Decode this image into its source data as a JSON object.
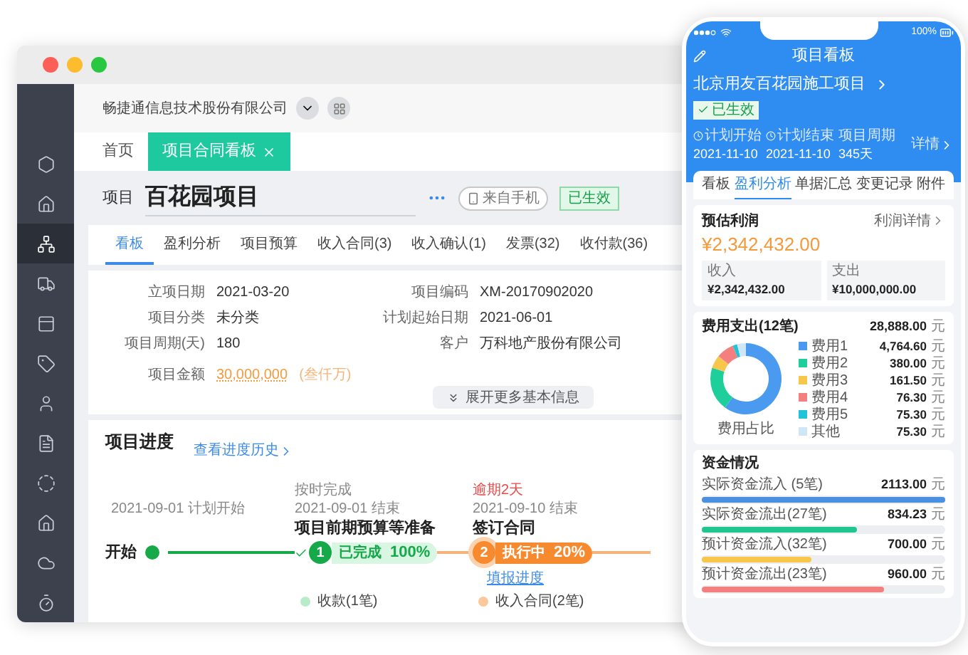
{
  "window": {
    "company": "畅捷通信息技术股份有限公司"
  },
  "sidebar": [
    {
      "selected": false
    },
    {
      "selected": false
    },
    {
      "selected": true
    },
    {
      "selected": false
    },
    {
      "selected": false
    },
    {
      "selected": false
    },
    {
      "selected": false
    },
    {
      "selected": false
    },
    {
      "selected": false
    },
    {
      "selected": false
    },
    {
      "selected": false
    },
    {
      "selected": false
    }
  ],
  "page_tabs": [
    {
      "label": "首页",
      "selected": false,
      "closable": false
    },
    {
      "label": "项目合同看板",
      "selected": true,
      "closable": true
    }
  ],
  "project": {
    "prefix": "项目",
    "name": "百花园项目",
    "source": "来自手机",
    "status": "已生效"
  },
  "tabs": [
    {
      "label": "看板",
      "selected": true
    },
    {
      "label": "盈利分析",
      "selected": false
    },
    {
      "label": "项目预算",
      "selected": false
    },
    {
      "label": "收入合同(3)",
      "selected": false
    },
    {
      "label": "收入确认(1)",
      "selected": false
    },
    {
      "label": "发票(32)",
      "selected": false
    },
    {
      "label": "收付款(36)",
      "selected": false
    }
  ],
  "info": {
    "left": [
      {
        "label": "立项日期",
        "value": "2021-03-20"
      },
      {
        "label": "项目分类",
        "value": "未分类"
      },
      {
        "label": "项目周期(天)",
        "value": "180"
      }
    ],
    "right": [
      {
        "label": "项目编码",
        "value": "XM-20170902020"
      },
      {
        "label": "计划起始日期",
        "value": "2021-06-01"
      },
      {
        "label": "客户",
        "value": "万科地产股份有限公司"
      }
    ],
    "amount": {
      "label": "项目金额",
      "value": "30,000,000",
      "words": "(叁仟万)"
    },
    "expand": "展开更多基本信息"
  },
  "progress": {
    "title": "项目进度",
    "history_link": "查看进度历史",
    "start": {
      "date": "2021-09-01 计划开始",
      "label": "开始"
    },
    "steps": [
      {
        "kind": "done",
        "number": "1",
        "note": "按时完成",
        "late": false,
        "date": "2021-09-01 结束",
        "title": "项目前期预算等准备",
        "state": "已完成",
        "percent": "100%",
        "items": [
          "收款(1笔)"
        ]
      },
      {
        "kind": "active",
        "number": "2",
        "note": "逾期2天",
        "late": true,
        "date": "2021-09-10 结束",
        "title": "签订合同",
        "state": "执行中",
        "percent": "20%",
        "link": "填报进度",
        "items": [
          "收入合同(2笔)"
        ]
      }
    ]
  },
  "phone": {
    "battery": "100%",
    "title": "项目看板",
    "project": "北京用友百花园施工项目",
    "status": "已生效",
    "stats": [
      {
        "kind": "date",
        "label": "计划开始",
        "value": "2021-11-10"
      },
      {
        "kind": "date",
        "label": "计划结束",
        "value": "2021-11-10"
      },
      {
        "kind": "plain",
        "label": "项目周期",
        "value": "345天"
      }
    ],
    "details": "详情",
    "tabs": [
      {
        "label": "看板",
        "selected": false
      },
      {
        "label": "盈利分析",
        "selected": true
      },
      {
        "label": "单据汇总",
        "selected": false
      },
      {
        "label": "变更记录",
        "selected": false
      },
      {
        "label": "附件",
        "selected": false
      }
    ],
    "profit": {
      "title": "预估利润",
      "link": "利润详情",
      "amount": "¥2,342,432.00",
      "income_label": "收入",
      "income": "¥2,342,432.00",
      "expense_label": "支出",
      "expense": "¥10,000,000.00"
    },
    "expenses": {
      "title": "费用支出(12笔)",
      "total": "28,888.00",
      "unit": "元",
      "chart_data": {
        "type": "donut",
        "title": "费用占比",
        "categories": [
          "费用1",
          "费用2",
          "费用3",
          "费用4",
          "费用5",
          "其他"
        ],
        "colors": [
          "#4a9bf0",
          "#1fcf9b",
          "#f7c64b",
          "#f47f7f",
          "#21c4d6",
          "#cfe6f7"
        ],
        "series": [
          {
            "values": [
              60,
              20,
              6,
              8,
              2,
              4
            ]
          }
        ]
      },
      "amounts": [
        {
          "amount": "4,764.60",
          "unit": "元"
        },
        {
          "amount": "380.00",
          "unit": "元"
        },
        {
          "amount": "161.50",
          "unit": "元"
        },
        {
          "amount": "76.30",
          "unit": "元"
        },
        {
          "amount": "75.30",
          "unit": "元"
        },
        {
          "amount": "75.30",
          "unit": "元"
        }
      ]
    },
    "funds": {
      "title": "资金情况",
      "items": [
        {
          "label": "实际资金流入 (5笔)",
          "amount": "2113.00",
          "unit": "元",
          "color": "#4a90e2",
          "level": 1
        },
        {
          "label": "实际资金流出(27笔)",
          "amount": "834.23",
          "unit": "元",
          "color": "#1fc78f",
          "level": 0.64
        },
        {
          "label": "预计资金流入(32笔)",
          "amount": "700.00",
          "unit": "元",
          "color": "#f7c64b",
          "level": 0.45
        },
        {
          "label": "预计资金流出(23笔)",
          "amount": "960.00",
          "unit": "元",
          "color": "#f47f7f",
          "level": 0.75
        }
      ]
    }
  }
}
